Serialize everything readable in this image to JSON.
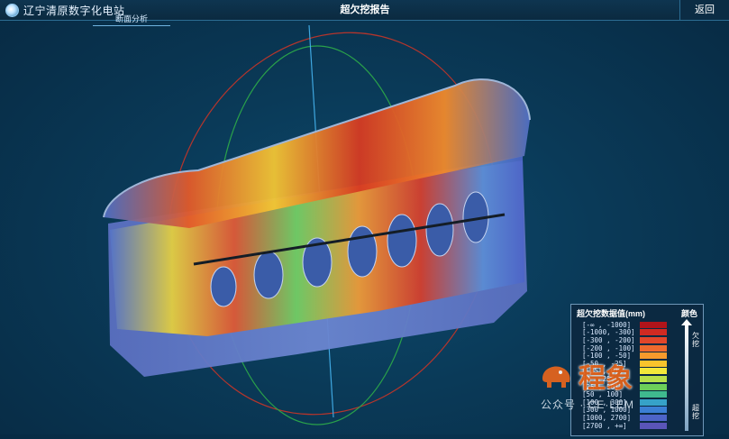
{
  "header": {
    "brand_title": "辽宁清原数字化电站",
    "sub_tab": "断面分析",
    "page_title": "超欠挖报告",
    "back_label": "返回"
  },
  "legend": {
    "title": "超欠挖数据值(mm)",
    "color_header": "颜色",
    "under_label": "欠挖",
    "over_label": "超挖",
    "rows": [
      {
        "range": "[-∞ , -1000]",
        "color": "#b0141a"
      },
      {
        "range": "[-1000, -300]",
        "color": "#d12a22"
      },
      {
        "range": "[-300 , -200]",
        "color": "#e2462a"
      },
      {
        "range": "[-200 , -100]",
        "color": "#ef6a2e"
      },
      {
        "range": "[-100 , -50]",
        "color": "#f79a2c"
      },
      {
        "range": "[-50 , -25]",
        "color": "#f9c42c"
      },
      {
        "range": "[-25 , 0]",
        "color": "#f3e83a"
      },
      {
        "range": "[0 , 25]",
        "color": "#b8e04a"
      },
      {
        "range": "[25 , 50]",
        "color": "#6ccf5a"
      },
      {
        "range": "[50 , 100]",
        "color": "#3fb98e"
      },
      {
        "range": "[100 , 300]",
        "color": "#36a2c8"
      },
      {
        "range": "[300 , 1000]",
        "color": "#3b7fd4"
      },
      {
        "range": "[1000, 2700]",
        "color": "#4d64c8"
      },
      {
        "range": "[2700 , +∞]",
        "color": "#5a55b8"
      }
    ]
  },
  "watermark": {
    "brand": "程象",
    "sub": "公众号 · CE·LEM"
  },
  "colors": {
    "accent": "#6fb3e0",
    "background": "#0a3a58"
  }
}
